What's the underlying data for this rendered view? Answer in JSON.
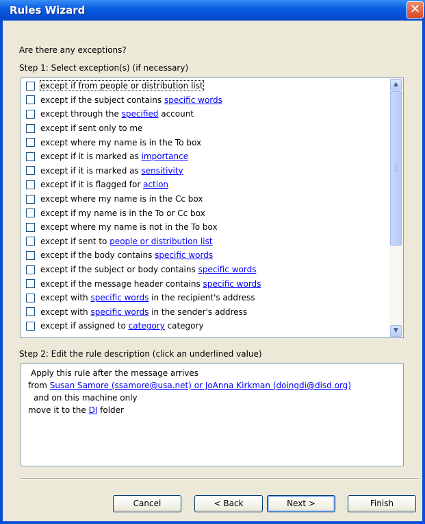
{
  "window": {
    "title": "Rules Wizard",
    "close_symbol": "✕"
  },
  "question": "Are there any exceptions?",
  "step1_label": "Step 1: Select exception(s) (if necessary)",
  "exceptions": [
    {
      "before": "except if from people or distribution list",
      "link": "",
      "after": "",
      "checked": false,
      "selected": true
    },
    {
      "before": "except if the subject contains ",
      "link": "specific words",
      "after": "",
      "checked": false
    },
    {
      "before": "except through the ",
      "link": "specified",
      "after": " account",
      "checked": false
    },
    {
      "before": "except if sent only to me",
      "link": "",
      "after": "",
      "checked": false
    },
    {
      "before": "except where my name is in the To box",
      "link": "",
      "after": "",
      "checked": false
    },
    {
      "before": "except if it is marked as ",
      "link": "importance",
      "after": "",
      "checked": false
    },
    {
      "before": "except if it is marked as ",
      "link": "sensitivity",
      "after": "",
      "checked": false
    },
    {
      "before": "except if it is flagged for ",
      "link": "action",
      "after": "",
      "checked": false
    },
    {
      "before": "except where my name is in the Cc box",
      "link": "",
      "after": "",
      "checked": false
    },
    {
      "before": "except if my name is in the To or Cc box",
      "link": "",
      "after": "",
      "checked": false
    },
    {
      "before": "except where my name is not in the To box",
      "link": "",
      "after": "",
      "checked": false
    },
    {
      "before": "except if sent to ",
      "link": "people or distribution list",
      "after": "",
      "checked": false
    },
    {
      "before": "except if the body contains ",
      "link": "specific words",
      "after": "",
      "checked": false
    },
    {
      "before": "except if the subject or body contains ",
      "link": "specific words",
      "after": "",
      "checked": false
    },
    {
      "before": "except if the message header contains ",
      "link": "specific words",
      "after": "",
      "checked": false
    },
    {
      "before": "except with ",
      "link": "specific words",
      "after": " in the recipient's address",
      "checked": false
    },
    {
      "before": "except with ",
      "link": "specific words",
      "after": " in the sender's address",
      "checked": false
    },
    {
      "before": "except if assigned to ",
      "link": "category",
      "after": " category",
      "checked": false
    }
  ],
  "scrollbar": {
    "up_icon": "▲",
    "down_icon": "▼"
  },
  "step2_label": "Step 2: Edit the rule description (click an underlined value)",
  "description": {
    "line1": "Apply this rule after the message arrives",
    "line2_prefix": "from ",
    "line2_link": "Susan Samore (ssamore@usa.net) or JoAnna Kirkman (doingdi@disd.org)",
    "line3": "and on this machine only",
    "line4_prefix": "move it to the ",
    "line4_link": "DI",
    "line4_suffix": " folder"
  },
  "buttons": {
    "cancel": "Cancel",
    "back": "< Back",
    "next": "Next >",
    "finish": "Finish"
  },
  "colors": {
    "title_bar": "#0a5fe0",
    "link": "#0000ff",
    "dialog_bg": "#ece9d8",
    "close_button": "#d84a2a"
  }
}
